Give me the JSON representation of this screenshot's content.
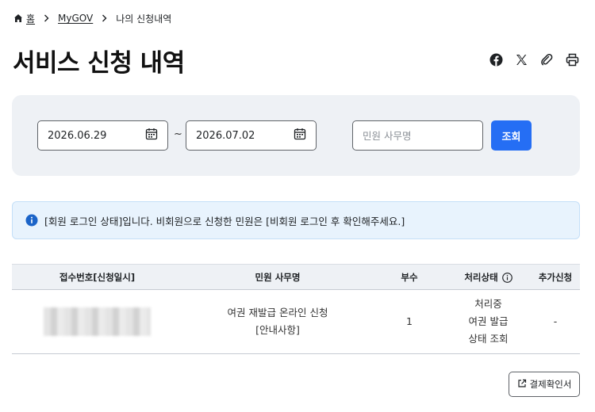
{
  "breadcrumb": {
    "home": "홈",
    "mygov": "MyGOV",
    "current": "나의 신청내역"
  },
  "page": {
    "title": "서비스 신청 내역"
  },
  "share": {
    "icons": [
      "facebook-icon",
      "x-icon",
      "link-icon",
      "print-icon"
    ]
  },
  "search": {
    "date_from": "2026.06.29",
    "date_to": "2026.07.02",
    "range_separator": "~",
    "keyword_placeholder": "민원 사무명",
    "keyword_value": "",
    "submit_label": "조회"
  },
  "notice": {
    "text": "[회원 로그인 상태]입니다. 비회원으로 신청한 민원은 [비회원 로그인 후 확인해주세요.]"
  },
  "table": {
    "headers": {
      "receipt_no": "접수번호[신청일시]",
      "service_name": "민원 사무명",
      "copies": "부수",
      "status": "처리상태",
      "extra": "추가신청"
    },
    "rows": [
      {
        "service_name": "여권 재발급 온라인 신청",
        "service_note": "[안내사항]",
        "copies": "1",
        "status": "처리중",
        "status_link_line1": "여권 발급",
        "status_link_line2": "상태 조회",
        "extra": "-"
      }
    ]
  },
  "footer": {
    "receipt_button": "결제확인서"
  },
  "colors": {
    "primary": "#256ef4",
    "panel_bg": "#eef1f5",
    "notice_bg": "#e8f3fd",
    "info_icon": "#1b64c8"
  }
}
